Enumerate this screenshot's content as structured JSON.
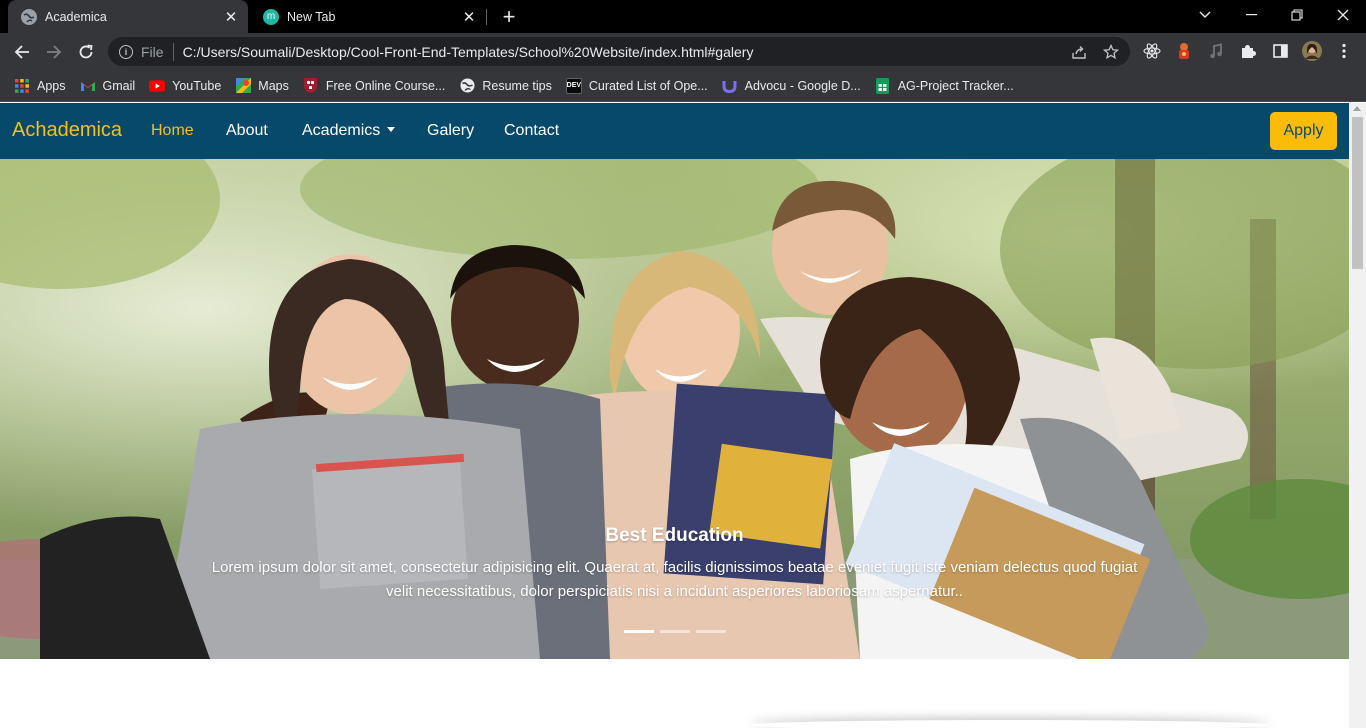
{
  "browser": {
    "tabs": [
      {
        "title": "Academica",
        "active": true
      },
      {
        "title": "New Tab",
        "active": false,
        "favicon_letter": "m"
      }
    ],
    "new_tab_symbol": "+",
    "address": {
      "scheme_label": "File",
      "url": "C:/Users/Soumali/Desktop/Cool-Front-End-Templates/School%20Website/index.html#galery"
    },
    "bookmarks": [
      {
        "label": "Apps",
        "icon": "apps-grid-icon"
      },
      {
        "label": "Gmail",
        "icon": "gmail-icon"
      },
      {
        "label": "YouTube",
        "icon": "youtube-icon"
      },
      {
        "label": "Maps",
        "icon": "maps-icon"
      },
      {
        "label": "Free Online Course...",
        "icon": "harvard-shield-icon"
      },
      {
        "label": "Resume tips",
        "icon": "globe-icon"
      },
      {
        "label": "Curated List of Ope...",
        "icon": "dev-icon",
        "icon_text": "DEV"
      },
      {
        "label": "Advocu - Google D...",
        "icon": "advocu-icon"
      },
      {
        "label": "AG-Project Tracker...",
        "icon": "sheets-icon"
      }
    ]
  },
  "site": {
    "brand": "Achademica",
    "nav": [
      {
        "label": "Home",
        "active": true
      },
      {
        "label": "About"
      },
      {
        "label": "Academics",
        "dropdown": true
      },
      {
        "label": "Galery"
      },
      {
        "label": "Contact"
      }
    ],
    "apply_label": "Apply",
    "colors": {
      "navbar": "#07496b",
      "accent": "#f4c01a",
      "apply_bg": "#fbbb09"
    },
    "carousel": {
      "title": "Best Education",
      "text": "Lorem ipsum dolor sit amet, consectetur adipisicing elit. Quaerat at, facilis dignissimos beatae eveniet fugit iste veniam delectus quod fugiat velit necessitatibus, dolor perspiciatis nisi a incidunt asperiores laboriosam aspernatur..",
      "slide_count": 3,
      "active_slide": 1
    }
  }
}
